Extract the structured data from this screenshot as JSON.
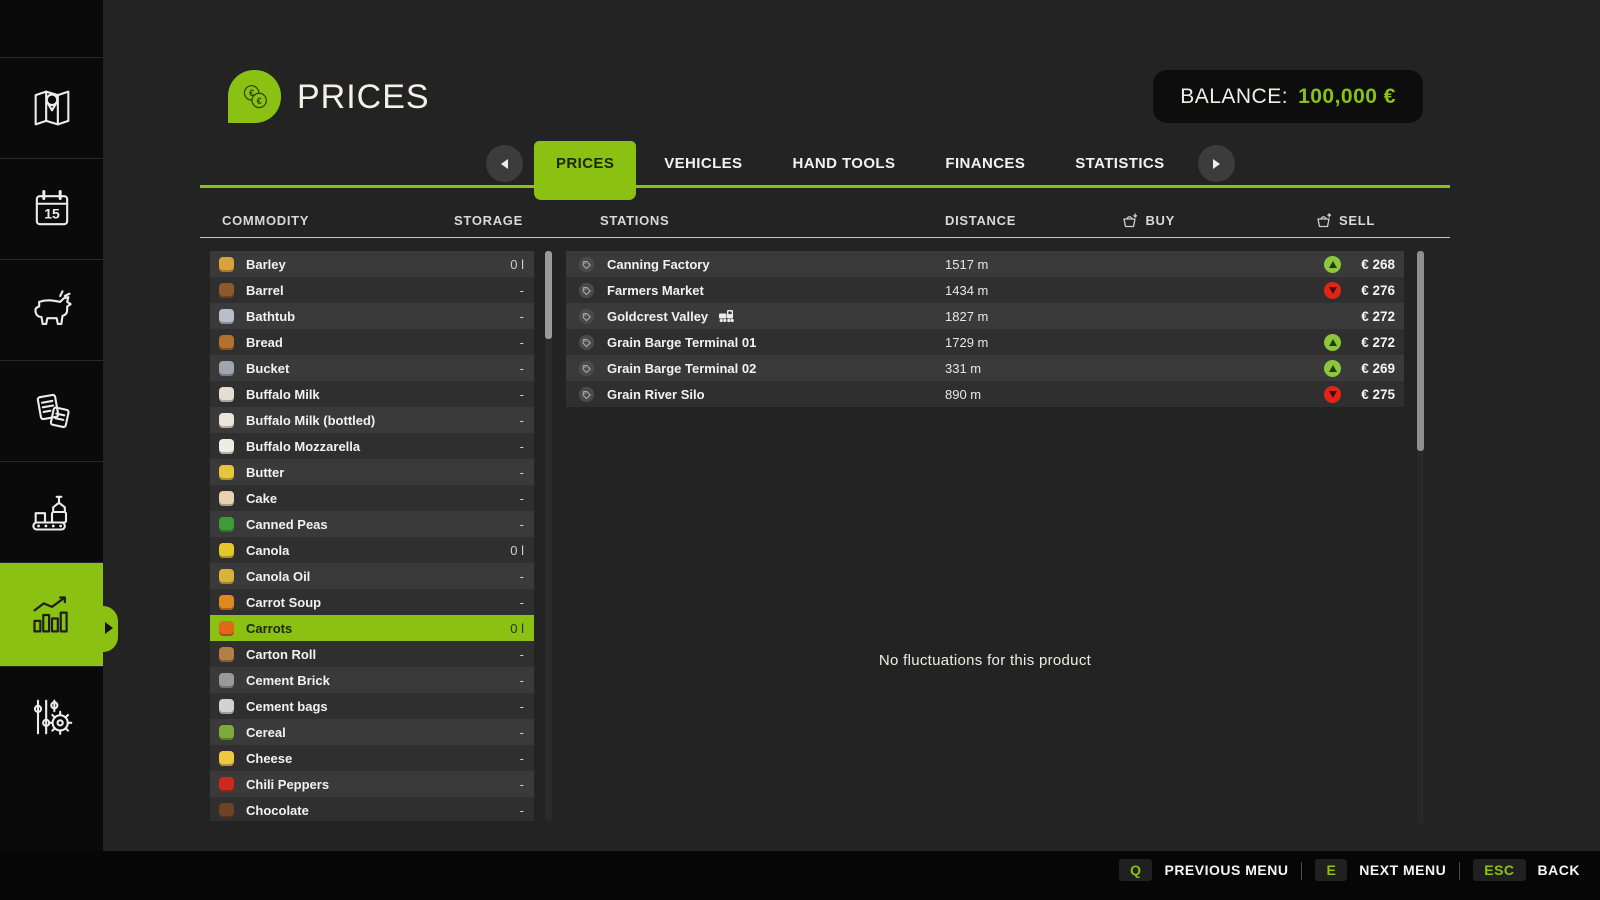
{
  "accent_green": "#8ac112",
  "header": {
    "title": "PRICES",
    "title_icon": "coins-icon",
    "balance_label": "BALANCE:",
    "balance_value": "100,000 €"
  },
  "sidebar": {
    "items": [
      {
        "icon": "map-icon",
        "active": false
      },
      {
        "icon": "calendar-icon",
        "active": false
      },
      {
        "icon": "animals-icon",
        "active": false
      },
      {
        "icon": "contracts-icon",
        "active": false
      },
      {
        "icon": "production-icon",
        "active": false
      },
      {
        "icon": "statistics-icon",
        "active": true
      },
      {
        "icon": "settings-icon",
        "active": false
      }
    ]
  },
  "tabs": {
    "items": [
      "PRICES",
      "VEHICLES",
      "HAND TOOLS",
      "FINANCES",
      "STATISTICS"
    ],
    "active": "PRICES",
    "left_arrow": "tab-prev-icon",
    "right_arrow": "tab-next-icon"
  },
  "columns": {
    "commodity": "COMMODITY",
    "storage": "STORAGE",
    "stations": "STATIONS",
    "distance": "DISTANCE",
    "buy": "BUY",
    "sell": "SELL",
    "buy_icon": "basket-down-icon",
    "sell_icon": "basket-up-icon"
  },
  "commodities": [
    {
      "name": "Barley",
      "storage": "0 l",
      "selected": false,
      "icon": "barley-icon",
      "icon_color": "#d9a33a"
    },
    {
      "name": "Barrel",
      "storage": "-",
      "selected": false,
      "icon": "barrel-icon",
      "icon_color": "#8a5a2b"
    },
    {
      "name": "Bathtub",
      "storage": "-",
      "selected": false,
      "icon": "bathtub-icon",
      "icon_color": "#b9bec9"
    },
    {
      "name": "Bread",
      "storage": "-",
      "selected": false,
      "icon": "bread-icon",
      "icon_color": "#b4702e"
    },
    {
      "name": "Bucket",
      "storage": "-",
      "selected": false,
      "icon": "bucket-icon",
      "icon_color": "#a0a5b0"
    },
    {
      "name": "Buffalo Milk",
      "storage": "-",
      "selected": false,
      "icon": "buffalo-milk-icon",
      "icon_color": "#e3ded2"
    },
    {
      "name": "Buffalo Milk (bottled)",
      "storage": "-",
      "selected": false,
      "icon": "buffalo-milk-bottled-icon",
      "icon_color": "#eae6dc"
    },
    {
      "name": "Buffalo Mozzarella",
      "storage": "-",
      "selected": false,
      "icon": "buffalo-mozzarella-icon",
      "icon_color": "#efece4"
    },
    {
      "name": "Butter",
      "storage": "-",
      "selected": false,
      "icon": "butter-icon",
      "icon_color": "#e9c53e"
    },
    {
      "name": "Cake",
      "storage": "-",
      "selected": false,
      "icon": "cake-icon",
      "icon_color": "#e6d2b0"
    },
    {
      "name": "Canned Peas",
      "storage": "-",
      "selected": false,
      "icon": "canned-peas-icon",
      "icon_color": "#3f9b35"
    },
    {
      "name": "Canola",
      "storage": "0 l",
      "selected": false,
      "icon": "canola-icon",
      "icon_color": "#e2c82a"
    },
    {
      "name": "Canola Oil",
      "storage": "-",
      "selected": false,
      "icon": "canola-oil-icon",
      "icon_color": "#d9b23a"
    },
    {
      "name": "Carrot Soup",
      "storage": "-",
      "selected": false,
      "icon": "carrot-soup-icon",
      "icon_color": "#e08a1e"
    },
    {
      "name": "Carrots",
      "storage": "0 l",
      "selected": true,
      "icon": "carrots-icon",
      "icon_color": "#e06a1a"
    },
    {
      "name": "Carton Roll",
      "storage": "-",
      "selected": false,
      "icon": "carton-roll-icon",
      "icon_color": "#b08046"
    },
    {
      "name": "Cement Brick",
      "storage": "-",
      "selected": false,
      "icon": "cement-brick-icon",
      "icon_color": "#9a9a9a"
    },
    {
      "name": "Cement bags",
      "storage": "-",
      "selected": false,
      "icon": "cement-bags-icon",
      "icon_color": "#d2d2d2"
    },
    {
      "name": "Cereal",
      "storage": "-",
      "selected": false,
      "icon": "cereal-icon",
      "icon_color": "#7daa3a"
    },
    {
      "name": "Cheese",
      "storage": "-",
      "selected": false,
      "icon": "cheese-icon",
      "icon_color": "#ecc93f"
    },
    {
      "name": "Chili Peppers",
      "storage": "-",
      "selected": false,
      "icon": "chili-peppers-icon",
      "icon_color": "#cc2a1e"
    },
    {
      "name": "Chocolate",
      "storage": "-",
      "selected": false,
      "icon": "chocolate-icon",
      "icon_color": "#6d4326"
    }
  ],
  "stations": [
    {
      "name": "Canning Factory",
      "train": false,
      "distance": "1517 m",
      "trend": "up",
      "price": "€ 268"
    },
    {
      "name": "Farmers Market",
      "train": false,
      "distance": "1434 m",
      "trend": "down",
      "price": "€ 276"
    },
    {
      "name": "Goldcrest Valley",
      "train": true,
      "distance": "1827 m",
      "trend": "none",
      "price": "€ 272"
    },
    {
      "name": "Grain Barge Terminal 01",
      "train": false,
      "distance": "1729 m",
      "trend": "up",
      "price": "€ 272"
    },
    {
      "name": "Grain Barge Terminal 02",
      "train": false,
      "distance": "331 m",
      "trend": "up",
      "price": "€ 269"
    },
    {
      "name": "Grain River Silo",
      "train": false,
      "distance": "890 m",
      "trend": "down",
      "price": "€ 275"
    }
  ],
  "empty_state": "No fluctuations for this product",
  "footer": {
    "items": [
      {
        "key": "Q",
        "label": "PREVIOUS MENU"
      },
      {
        "key": "E",
        "label": "NEXT MENU"
      },
      {
        "key": "ESC",
        "label": "BACK"
      }
    ]
  }
}
